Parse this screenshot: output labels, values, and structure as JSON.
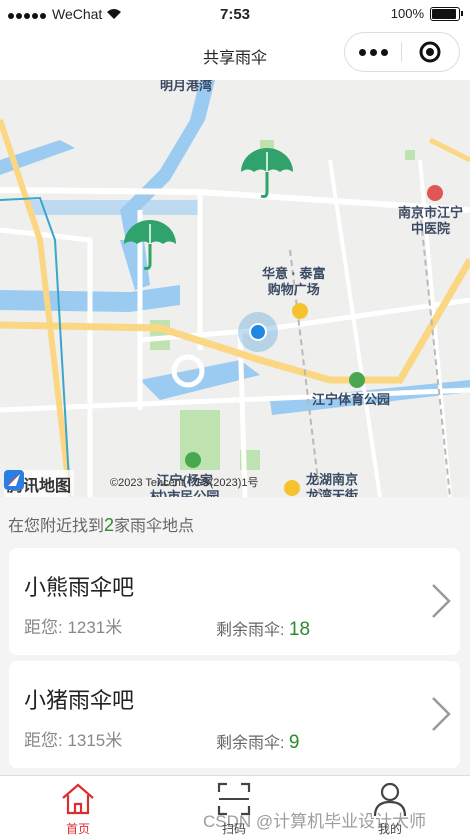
{
  "status": {
    "carrier": "WeChat",
    "time": "7:53",
    "battery": "100%"
  },
  "nav": {
    "title": "共享雨伞"
  },
  "map": {
    "labels": {
      "top": "明月港湾",
      "hospital": "南京市江宁\n中医院",
      "mall": "华意 · 泰富\n购物广场",
      "park": "江宁体育公园",
      "bottom_left": "江宁(杨家\n村)市民公园",
      "bottom_right": "龙湖南京\n龙湾天街"
    },
    "logo": "腾讯地图",
    "copyright": "©2023 Tencent - GS(2023)1号"
  },
  "found": {
    "prefix": "在您附近找到",
    "count": "2",
    "suffix": "家雨伞地点"
  },
  "locations": [
    {
      "name": "小熊雨伞吧",
      "distance": "距您: 1231米",
      "remain_label": "剩余雨伞:",
      "remain": "18"
    },
    {
      "name": "小猪雨伞吧",
      "distance": "距您: 1315米",
      "remain_label": "剩余雨伞:",
      "remain": "9"
    }
  ],
  "tabs": [
    {
      "label": "首页",
      "icon": "home-icon",
      "active": true
    },
    {
      "label": "扫码",
      "icon": "scan-icon",
      "active": false
    },
    {
      "label": "我的",
      "icon": "user-icon",
      "active": false
    }
  ],
  "watermark": "CSDN @计算机毕业设计大师",
  "colors": {
    "accent_green": "#2d8a2d",
    "umbrella": "#2fa36b",
    "active_tab": "#d8302f"
  }
}
